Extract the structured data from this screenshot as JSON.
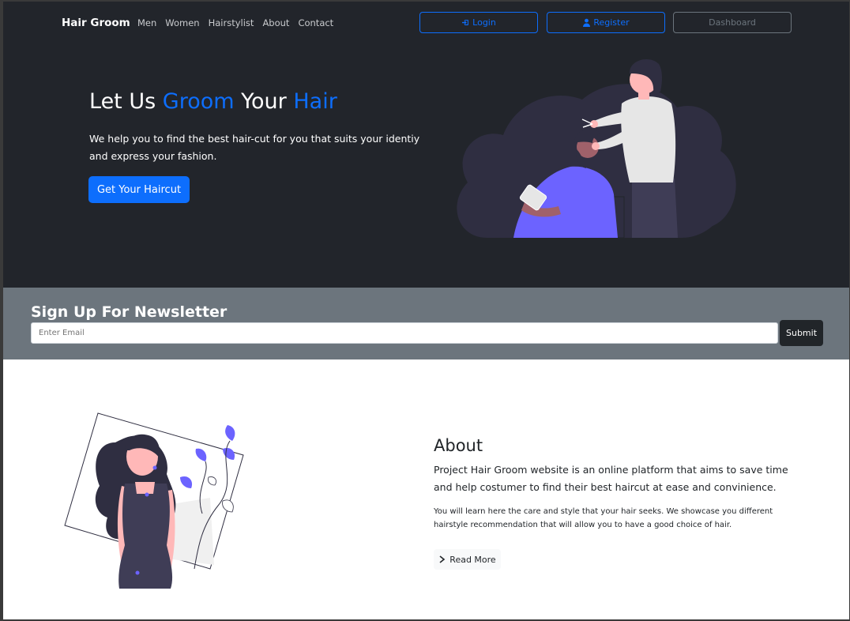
{
  "navbar": {
    "brand": "Hair Groom",
    "links": [
      "Men",
      "Women",
      "Hairstylist",
      "About",
      "Contact"
    ],
    "login_label": "Login",
    "register_label": "Register",
    "dashboard_label": "Dashboard"
  },
  "hero": {
    "title_part1": "Let Us ",
    "title_part2": "Groom",
    "title_part3": " Your ",
    "title_part4": "Hair",
    "text": "We help you to find the best hair-cut for you that suits your identiy and express your fashion.",
    "button_label": "Get Your Haircut"
  },
  "newsletter": {
    "title": "Sign Up For Newsletter",
    "email_placeholder": "Enter Email",
    "submit_label": "Submit"
  },
  "about": {
    "title": "About",
    "lead": "Project Hair Groom website is an online platform that aims to save time and help costumer to find their best haircut at ease and convinience.",
    "detail": "You will learn here the care and style that your hair seeks. We showcase you different hairstyle recommendation that will allow you to have a good choice of hair.",
    "read_more_label": "Read More"
  },
  "colors": {
    "dark_bg": "#22252b",
    "accent": "#0d6efd",
    "newsletter_bg": "#6c757d",
    "illustration_purple": "#6c63ff"
  },
  "icons": {
    "login": "sign-in-icon",
    "register": "user-icon",
    "read_more": "chevron-right-icon"
  }
}
